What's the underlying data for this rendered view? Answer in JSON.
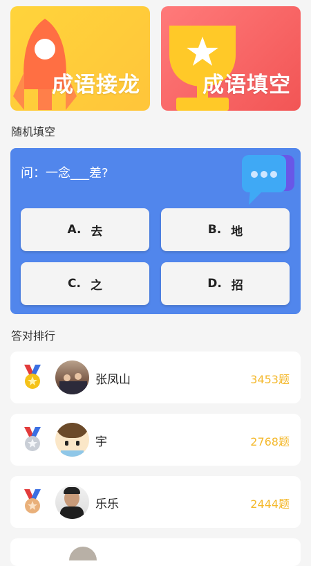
{
  "top_cards": [
    {
      "title": "成语接龙",
      "icon": "rocket-icon",
      "color": "#ffd43b"
    },
    {
      "title": "成语填空",
      "icon": "trophy-icon",
      "color": "#f25555"
    }
  ],
  "random_fill": {
    "section_title": "随机填空",
    "question": "问：一念___差?",
    "options": [
      {
        "letter": "A.",
        "text": "去"
      },
      {
        "letter": "B.",
        "text": "地"
      },
      {
        "letter": "C.",
        "text": "之"
      },
      {
        "letter": "D.",
        "text": "招"
      }
    ]
  },
  "ranking": {
    "section_title": "答对排行",
    "entries": [
      {
        "name": "张凤山",
        "count": "3453题",
        "medal": "gold"
      },
      {
        "name": "宇",
        "count": "2768题",
        "medal": "silver"
      },
      {
        "name": "乐乐",
        "count": "2444题",
        "medal": "bronze"
      }
    ]
  },
  "colors": {
    "accent": "#5186ec",
    "count": "#f4b82b"
  }
}
